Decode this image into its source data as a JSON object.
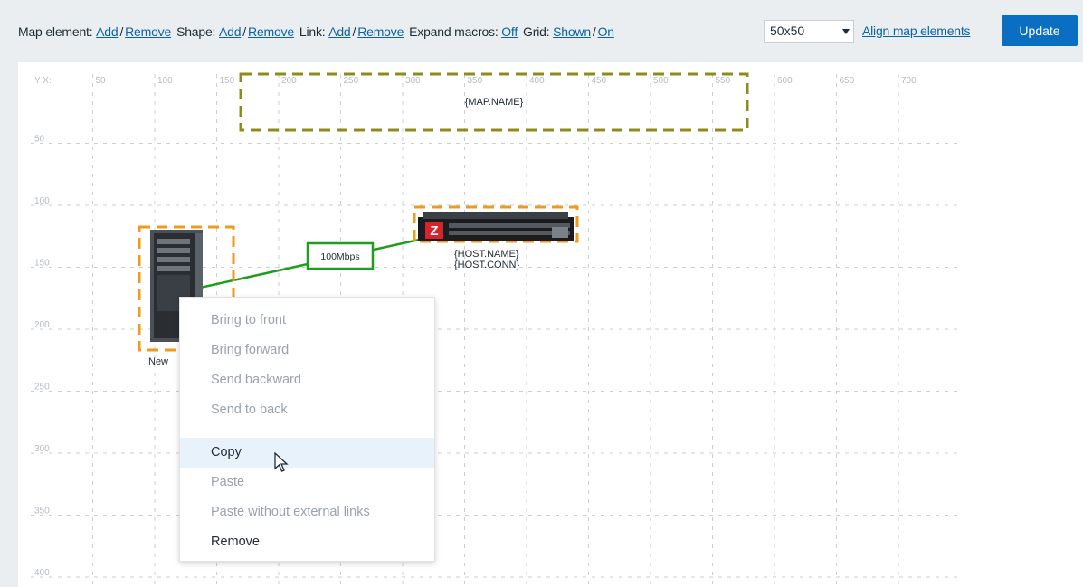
{
  "toolbar": {
    "map_element_label": "Map element:",
    "map_element_add": "Add",
    "map_element_remove": "Remove",
    "shape_label": "Shape:",
    "shape_add": "Add",
    "shape_remove": "Remove",
    "link_label": "Link:",
    "link_add": "Add",
    "link_remove": "Remove",
    "expand_macros_label": "Expand macros:",
    "expand_macros_value": "Off",
    "grid_label": "Grid:",
    "grid_shown": "Shown",
    "grid_on": "On",
    "grid_size": "50x50",
    "align_label": "Align map elements",
    "update_label": "Update",
    "slash": "/"
  },
  "grid": {
    "corner_label": "Y X:",
    "x_labels": [
      "50",
      "100",
      "150",
      "200",
      "250",
      "300",
      "350",
      "400",
      "450",
      "500",
      "550",
      "600",
      "650",
      "700"
    ],
    "y_labels": [
      "50",
      "100",
      "150",
      "200",
      "250",
      "300",
      "350",
      "400"
    ]
  },
  "map": {
    "title_macro": "{MAP.NAME}",
    "link_label": "100Mbps",
    "host_name_macro": "{HOST.NAME}",
    "host_conn_macro": "{HOST.CONN}",
    "server_label": "New"
  },
  "context_menu": {
    "items": [
      {
        "label": "Bring to front",
        "enabled": false
      },
      {
        "label": "Bring forward",
        "enabled": false
      },
      {
        "label": "Send backward",
        "enabled": false
      },
      {
        "label": "Send to back",
        "enabled": false
      },
      {
        "label": "Copy",
        "enabled": true,
        "hover": true
      },
      {
        "label": "Paste",
        "enabled": false
      },
      {
        "label": "Paste without external links",
        "enabled": false
      },
      {
        "label": "Remove",
        "enabled": true
      }
    ]
  },
  "colors": {
    "link_color": "#1f9d1f",
    "shape_border": "#8c8c1e",
    "selection_border": "#f09a1a",
    "button_blue": "#0a6fc2",
    "link_text": "#0a63a6"
  },
  "icons": {
    "server": "server-icon",
    "switch": "network-switch-icon",
    "cursor": "mouse-pointer-icon"
  }
}
